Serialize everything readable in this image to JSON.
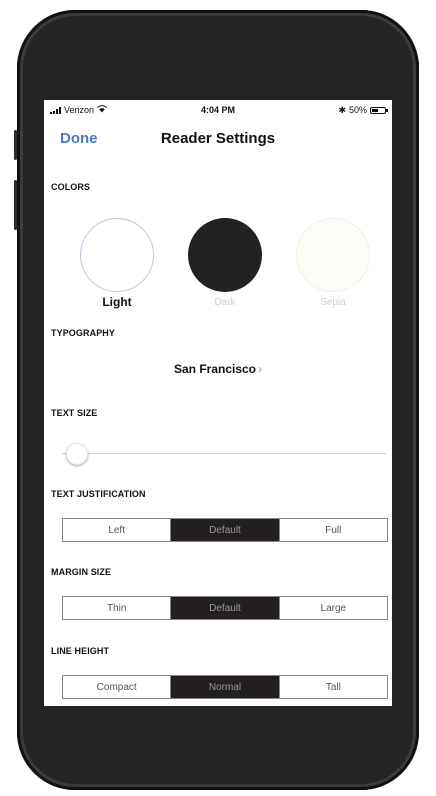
{
  "status": {
    "carrier": "Verizon",
    "time": "4:04 PM",
    "bluetooth": "✱",
    "battery": "50%",
    "battery_level": 0.5
  },
  "navbar": {
    "done_label": "Done",
    "title": "Reader Settings"
  },
  "colors": {
    "section_label": "COLORS",
    "options": [
      {
        "label": "Light",
        "fill": "#ffffff",
        "selected": true
      },
      {
        "label": "Dark",
        "fill": "#222222",
        "selected": false
      },
      {
        "label": "Sepia",
        "fill": "#fdfcf6",
        "selected": false
      }
    ]
  },
  "typography": {
    "section_label": "TYPOGRAPHY",
    "font_name": "San Francisco",
    "chevron": "›"
  },
  "text_size": {
    "section_label": "TEXT SIZE",
    "level": 0.0
  },
  "justification": {
    "section_label": "TEXT JUSTIFICATION",
    "options": [
      "Left",
      "Default",
      "Full"
    ],
    "selected": "Default"
  },
  "margin": {
    "section_label": "MARGIN SIZE",
    "options": [
      "Thin",
      "Default",
      "Large"
    ],
    "selected": "Default"
  },
  "line_height": {
    "section_label": "LINE HEIGHT",
    "options": [
      "Compact",
      "Normal",
      "Tall"
    ],
    "selected": "Normal"
  }
}
